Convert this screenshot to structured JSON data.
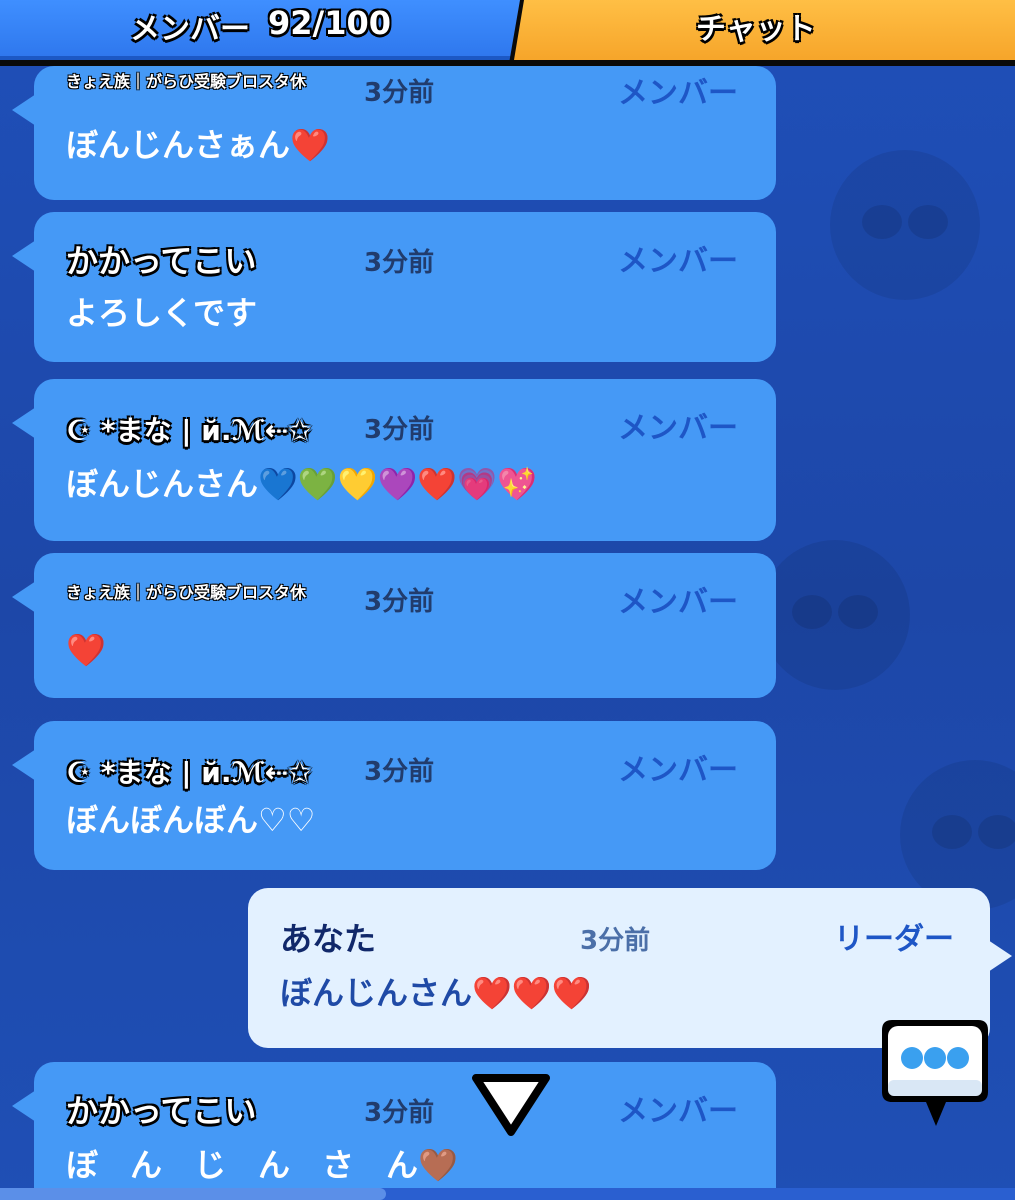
{
  "tabs": {
    "members_label": "メンバー",
    "members_count": "92/100",
    "chat_label": "チャット"
  },
  "messages": [
    {
      "name": "きょえ族｜がらひ受験ブロスタ休",
      "time": "3分前",
      "role": "メンバー",
      "text": "ぼんじんさぁん❤️"
    },
    {
      "name": "かかってこい",
      "time": "3分前",
      "role": "メンバー",
      "text": "よろしくです"
    },
    {
      "name": "☪︎ *まな | й.ℳ⇠✩",
      "time": "3分前",
      "role": "メンバー",
      "text": "ぼんじんさん💙💚💛💜❤️💗💖"
    },
    {
      "name": "きょえ族｜がらひ受験ブロスタ休",
      "time": "3分前",
      "role": "メンバー",
      "text": "❤️"
    },
    {
      "name": "☪︎ *まな | й.ℳ⇠✩",
      "time": "3分前",
      "role": "メンバー",
      "text": "ぼんぼんぼん♡♡"
    },
    {
      "name": "あなた",
      "time": "3分前",
      "role": "リーダー",
      "text": "ぼんじんさん❤️❤️❤️"
    },
    {
      "name": "かかってこい",
      "time": "3分前",
      "role": "メンバー",
      "text": "ぼ　ん　じ　ん　さ　ん🤎"
    }
  ],
  "scroll_progress": 0.38,
  "colors": {
    "member_bubble": "#4599f6",
    "self_bubble": "#e3f1ff",
    "members_tab": "#3f8fff",
    "chat_tab": "#f6a52a"
  }
}
